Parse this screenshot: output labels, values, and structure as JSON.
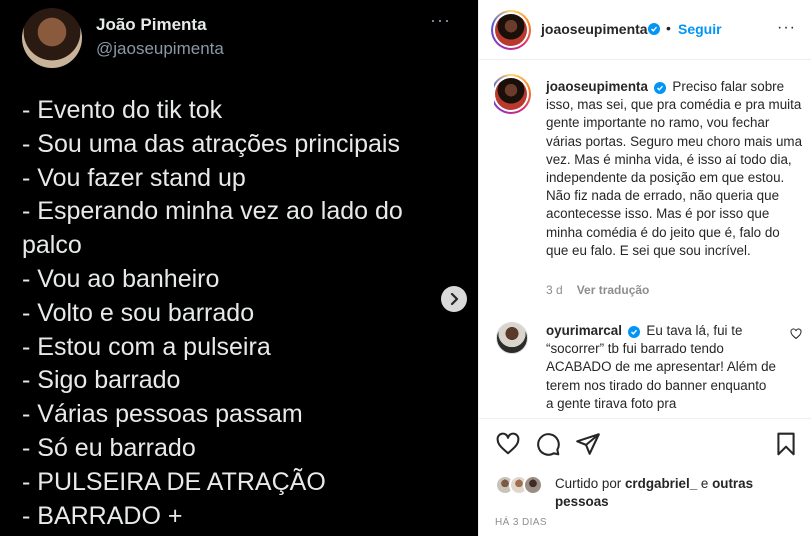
{
  "tweet": {
    "name": "João Pimenta",
    "handle": "@jaoseupimenta",
    "more": "···",
    "lines": [
      "- Evento do tik tok",
      "- Sou uma das atrações principais",
      "- Vou fazer stand up",
      "- Esperando minha vez ao lado do",
      "palco",
      "- Vou ao banheiro",
      "- Volto e sou barrado",
      "- Estou com a pulseira",
      "- Sigo barrado",
      "- Várias pessoas passam",
      "- Só eu barrado",
      "- PULSEIRA DE ATRAÇÃO",
      "- BARRADO +"
    ]
  },
  "header": {
    "username": "joaoseupimenta",
    "separator": "•",
    "follow_label": "Seguir",
    "more": "···"
  },
  "caption": {
    "username": "joaoseupimenta",
    "text": "Preciso falar sobre isso, mas sei, que pra comédia e pra muita gente importante no ramo, vou fechar várias portas. Seguro meu choro mais uma vez. Mas é minha vida, é isso aí todo dia, independente da posição em que estou. Não fiz nada de errado, não queria que acontecesse isso. Mas é por isso que minha comédia é do jeito que é, falo do que eu falo. E sei que sou incrível.",
    "time": "3 d",
    "translate_label": "Ver tradução"
  },
  "comment": {
    "username": "oyurimarcal",
    "text": "Eu tava lá, fui te “socorrer” tb fui barrado tendo ACABADO de me apresentar! Além de terem nos tirado do banner enquanto a gente tirava foto pra"
  },
  "likes": {
    "prefix": "Curtido por",
    "user": "crdgabriel_",
    "conj": "e",
    "others": "outras pessoas"
  },
  "posted_ago": "HÁ 3 DIAS",
  "colors": {
    "accent": "#0095f6",
    "text": "#262626",
    "muted": "#8e8e8e"
  }
}
